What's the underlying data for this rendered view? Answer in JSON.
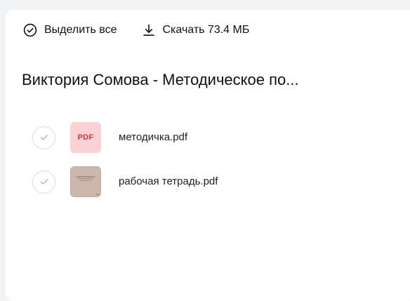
{
  "toolbar": {
    "select_all_label": "Выделить все",
    "select_all_icon": "check-circle-icon",
    "download_label": "Скачать 73.4 МБ",
    "download_icon": "download-icon"
  },
  "folder": {
    "title": "Виктория Сомова - Методическое по..."
  },
  "files": [
    {
      "name": "методичка.pdf",
      "thumb_text": "PDF",
      "thumb_type": "pdf-badge",
      "selected": false
    },
    {
      "name": "рабочая тетрадь.pdf",
      "thumb_type": "document-preview",
      "selected": false
    }
  ],
  "colors": {
    "pdf_badge_bg": "#fbd2d3",
    "pdf_badge_text": "#e1323b",
    "preview_bg": "#cdb7ad"
  }
}
